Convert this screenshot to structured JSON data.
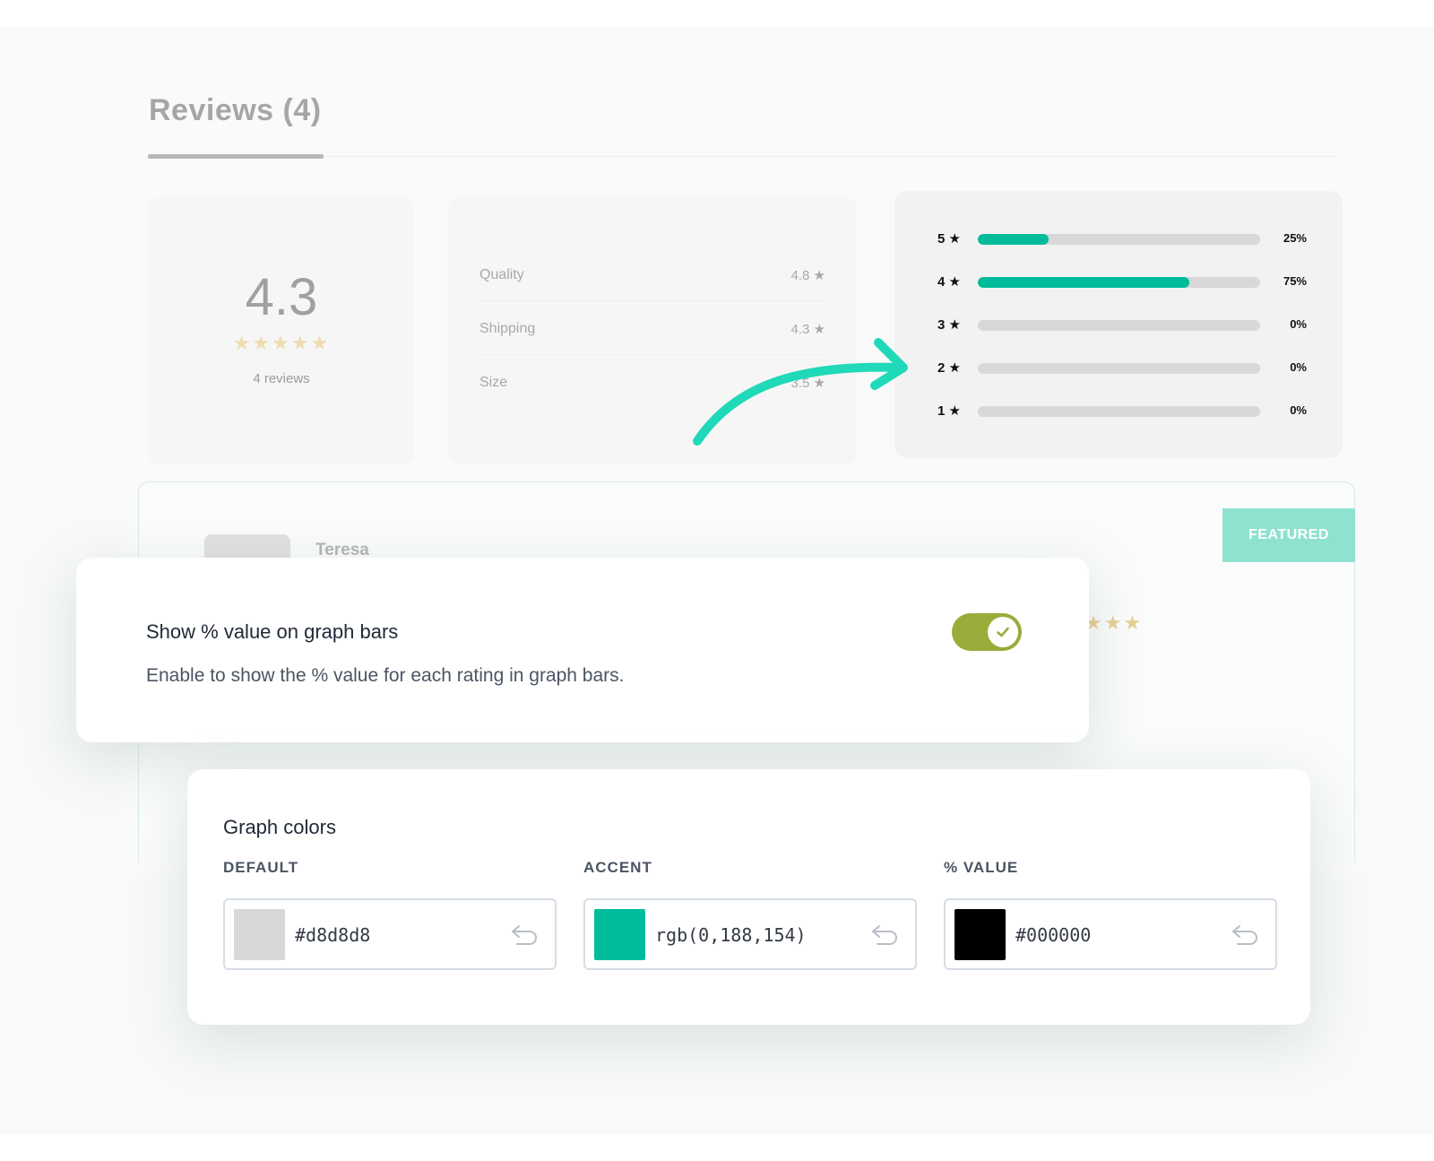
{
  "reviews": {
    "title": "Reviews (4)",
    "summary": {
      "average": "4.3",
      "stars": "★★★★★",
      "count_label": "4 reviews"
    },
    "criteria": [
      {
        "label": "Quality",
        "value": "4.8 ★"
      },
      {
        "label": "Shipping",
        "value": "4.3 ★"
      },
      {
        "label": "Size",
        "value": "3.5 ★"
      }
    ],
    "distribution": [
      {
        "label": "5 ★",
        "percent": 25,
        "percent_label": "25%"
      },
      {
        "label": "4 ★",
        "percent": 75,
        "percent_label": "75%"
      },
      {
        "label": "3 ★",
        "percent": 0,
        "percent_label": "0%"
      },
      {
        "label": "2 ★",
        "percent": 0,
        "percent_label": "0%"
      },
      {
        "label": "1 ★",
        "percent": 0,
        "percent_label": "0%"
      }
    ]
  },
  "review_card": {
    "badge": "FEATURED",
    "reviewer": "Teresa",
    "stars": "★★★"
  },
  "toggle_setting": {
    "title": "Show % value on graph bars",
    "description": "Enable to show the % value for each rating in graph bars.",
    "enabled": true
  },
  "graph_colors": {
    "title": "Graph colors",
    "fields": [
      {
        "label": "DEFAULT",
        "value": "#d8d8d8",
        "swatch": "#d8d8d8"
      },
      {
        "label": "ACCENT",
        "value": "rgb(0,188,154)",
        "swatch": "#00bc9a"
      },
      {
        "label": "% VALUE",
        "value": "#000000",
        "swatch": "#000000"
      }
    ]
  },
  "colors": {
    "accent": "#00bc9a",
    "arrow": "#1fd9b8",
    "toggle_on": "#9bab3a",
    "featured": "#8ee2cf"
  },
  "icons": {
    "reset": "undo-arrow-icon",
    "check": "check-icon",
    "arrow": "curved-arrow-icon"
  }
}
